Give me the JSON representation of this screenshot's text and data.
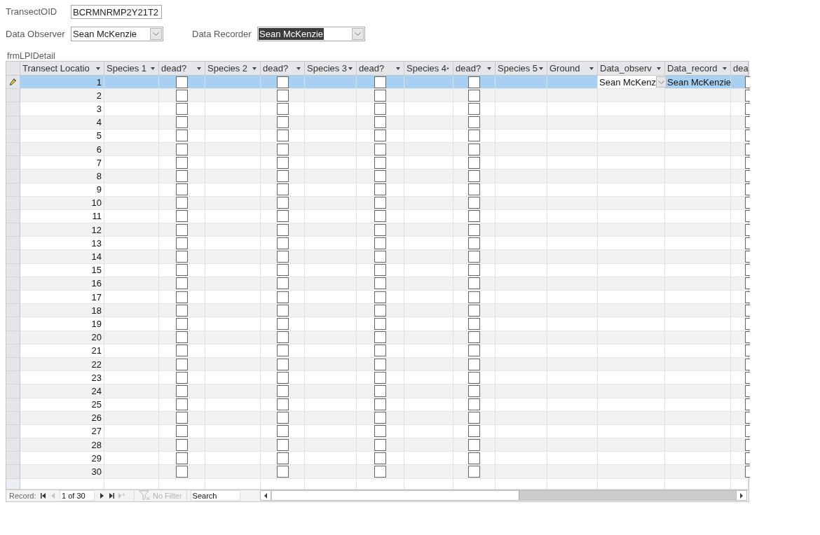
{
  "form": {
    "transect_oid": {
      "label": "TransectOID",
      "value": "BCRMNRMP2Y21T2"
    },
    "data_observer": {
      "label": "Data Observer",
      "value": "Sean McKenzie",
      "text_selected": false
    },
    "data_recorder": {
      "label": "Data Recorder",
      "value": "Sean McKenzie",
      "text_selected": true
    }
  },
  "subform": {
    "title": "frmLPIDetail",
    "columns": [
      {
        "label": "Transect Locatio",
        "kind": "location",
        "dropdown": true
      },
      {
        "label": "Species 1",
        "kind": "species",
        "dropdown": true
      },
      {
        "label": "dead?",
        "kind": "dead",
        "dropdown": true
      },
      {
        "label": "Species 2",
        "kind": "species",
        "dropdown": true
      },
      {
        "label": "dead?",
        "kind": "dead",
        "dropdown": true
      },
      {
        "label": "Species 3",
        "kind": "species",
        "dropdown": true
      },
      {
        "label": "dead?",
        "kind": "dead",
        "dropdown": true
      },
      {
        "label": "Species 4",
        "kind": "species",
        "dropdown": true
      },
      {
        "label": "dead?",
        "kind": "dead",
        "dropdown": true
      },
      {
        "label": "Species 5",
        "kind": "species",
        "dropdown": true
      },
      {
        "label": "Ground",
        "kind": "ground",
        "dropdown": true
      },
      {
        "label": "Data_observ",
        "kind": "observer",
        "dropdown": true
      },
      {
        "label": "Data_record",
        "kind": "recorder",
        "dropdown": true
      },
      {
        "label": "dea",
        "kind": "dead"
      }
    ],
    "rows": [
      {
        "location": "1",
        "selected": true,
        "editing": true,
        "dead": [
          false,
          false,
          false,
          false,
          false
        ],
        "data_observer": {
          "value": "Sean McKenz",
          "focused": true
        },
        "data_recorder": "Sean McKenzie"
      },
      {
        "location": "2",
        "selected": false,
        "editing": false,
        "dead": [
          false,
          false,
          false,
          false,
          false
        ]
      },
      {
        "location": "3",
        "selected": false,
        "editing": false,
        "dead": [
          false,
          false,
          false,
          false,
          false
        ]
      },
      {
        "location": "4",
        "selected": false,
        "editing": false,
        "dead": [
          false,
          false,
          false,
          false,
          false
        ]
      },
      {
        "location": "5",
        "selected": false,
        "editing": false,
        "dead": [
          false,
          false,
          false,
          false,
          false
        ]
      },
      {
        "location": "6",
        "selected": false,
        "editing": false,
        "dead": [
          false,
          false,
          false,
          false,
          false
        ]
      },
      {
        "location": "7",
        "selected": false,
        "editing": false,
        "dead": [
          false,
          false,
          false,
          false,
          false
        ]
      },
      {
        "location": "8",
        "selected": false,
        "editing": false,
        "dead": [
          false,
          false,
          false,
          false,
          false
        ]
      },
      {
        "location": "9",
        "selected": false,
        "editing": false,
        "dead": [
          false,
          false,
          false,
          false,
          false
        ]
      },
      {
        "location": "10",
        "selected": false,
        "editing": false,
        "dead": [
          false,
          false,
          false,
          false,
          false
        ]
      },
      {
        "location": "11",
        "selected": false,
        "editing": false,
        "dead": [
          false,
          false,
          false,
          false,
          false
        ]
      },
      {
        "location": "12",
        "selected": false,
        "editing": false,
        "dead": [
          false,
          false,
          false,
          false,
          false
        ]
      },
      {
        "location": "13",
        "selected": false,
        "editing": false,
        "dead": [
          false,
          false,
          false,
          false,
          false
        ]
      },
      {
        "location": "14",
        "selected": false,
        "editing": false,
        "dead": [
          false,
          false,
          false,
          false,
          false
        ]
      },
      {
        "location": "15",
        "selected": false,
        "editing": false,
        "dead": [
          false,
          false,
          false,
          false,
          false
        ]
      },
      {
        "location": "16",
        "selected": false,
        "editing": false,
        "dead": [
          false,
          false,
          false,
          false,
          false
        ]
      },
      {
        "location": "17",
        "selected": false,
        "editing": false,
        "dead": [
          false,
          false,
          false,
          false,
          false
        ]
      },
      {
        "location": "18",
        "selected": false,
        "editing": false,
        "dead": [
          false,
          false,
          false,
          false,
          false
        ]
      },
      {
        "location": "19",
        "selected": false,
        "editing": false,
        "dead": [
          false,
          false,
          false,
          false,
          false
        ]
      },
      {
        "location": "20",
        "selected": false,
        "editing": false,
        "dead": [
          false,
          false,
          false,
          false,
          false
        ]
      },
      {
        "location": "21",
        "selected": false,
        "editing": false,
        "dead": [
          false,
          false,
          false,
          false,
          false
        ]
      },
      {
        "location": "22",
        "selected": false,
        "editing": false,
        "dead": [
          false,
          false,
          false,
          false,
          false
        ]
      },
      {
        "location": "23",
        "selected": false,
        "editing": false,
        "dead": [
          false,
          false,
          false,
          false,
          false
        ]
      },
      {
        "location": "24",
        "selected": false,
        "editing": false,
        "dead": [
          false,
          false,
          false,
          false,
          false
        ]
      },
      {
        "location": "25",
        "selected": false,
        "editing": false,
        "dead": [
          false,
          false,
          false,
          false,
          false
        ]
      },
      {
        "location": "26",
        "selected": false,
        "editing": false,
        "dead": [
          false,
          false,
          false,
          false,
          false
        ]
      },
      {
        "location": "27",
        "selected": false,
        "editing": false,
        "dead": [
          false,
          false,
          false,
          false,
          false
        ]
      },
      {
        "location": "28",
        "selected": false,
        "editing": false,
        "dead": [
          false,
          false,
          false,
          false,
          false
        ]
      },
      {
        "location": "29",
        "selected": false,
        "editing": false,
        "dead": [
          false,
          false,
          false,
          false,
          false
        ]
      },
      {
        "location": "30",
        "selected": false,
        "editing": false,
        "dead": [
          false,
          false,
          false,
          false,
          false
        ]
      }
    ],
    "navigation": {
      "label": "Record:",
      "position": "1 of 30",
      "buttons": [
        {
          "kind": "first",
          "disabled": false
        },
        {
          "kind": "previous",
          "disabled": true
        },
        {
          "kind": "next",
          "disabled": false
        },
        {
          "kind": "last",
          "disabled": false
        },
        {
          "kind": "new",
          "disabled": true
        }
      ],
      "filter": {
        "label": "No Filter",
        "disabled": true
      },
      "search": {
        "placeholder": "Search"
      }
    }
  }
}
